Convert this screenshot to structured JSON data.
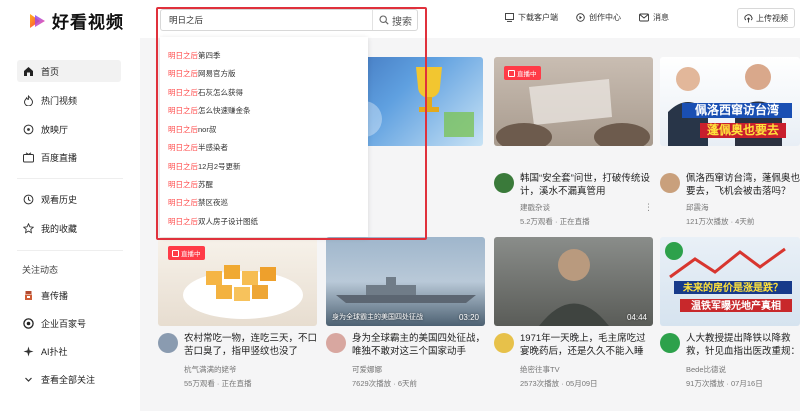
{
  "brand": {
    "name": "好看视频",
    "accent": "#ff3b47"
  },
  "search": {
    "query": "明日之后",
    "button_label": "搜索"
  },
  "header_actions": [
    {
      "label": "下载客户端",
      "icon": "download-client-icon"
    },
    {
      "label": "创作中心",
      "icon": "creator-icon"
    },
    {
      "label": "消息",
      "icon": "message-icon"
    }
  ],
  "upload_label": "上传视频",
  "sidebar": {
    "items": [
      {
        "label": "首页",
        "icon": "home-icon",
        "active": true
      },
      {
        "label": "热门视频",
        "icon": "hot-icon"
      },
      {
        "label": "放映厅",
        "icon": "cinema-icon"
      },
      {
        "label": "百度直播",
        "icon": "live-icon"
      }
    ],
    "items2": [
      {
        "label": "观看历史",
        "icon": "history-icon"
      },
      {
        "label": "我的收藏",
        "icon": "favorite-icon"
      }
    ],
    "follow_heading": "关注动态",
    "follow_items": [
      {
        "label": "喜传播",
        "icon": "xichuanbo-icon"
      },
      {
        "label": "企业百家号",
        "icon": "enterprise-icon"
      },
      {
        "label": "AI扑社",
        "icon": "ai-icon"
      },
      {
        "label": "查看全部关注",
        "icon": "chevron-down-icon"
      }
    ]
  },
  "suggestions": {
    "prefix": "明日之后",
    "items": [
      "第四季",
      "网易官方版",
      "石灰怎么获得",
      "怎么快速赚金条",
      "nor叔",
      "半感染者",
      "12月2号更新",
      "苏醒",
      "禁区夜巡",
      "双人房子设计图纸"
    ]
  },
  "row1": [
    {
      "title": "韩国“安全套”问世，打破传统设计，溪水不漏真管用",
      "author": "建戳杂谈",
      "meta": "5.2万观看 · 正在直播",
      "live_badge": "直播中"
    },
    {
      "title": "佩洛西窜访台湾，蓬佩奥也要去，飞机会被击落吗？",
      "author": "邱震海",
      "meta": "121万次播放 · 4天前",
      "thumb_text_1": "佩洛西窜访台湾",
      "thumb_text_2": "蓬佩奥也要去"
    }
  ],
  "row2": [
    {
      "title": "农村常吃一物，连吃三天，不口苦口臭了，指甲竖纹也没了",
      "author": "杭气满满的姥爷",
      "meta": "55万观看 · 正在直播",
      "live_badge": "直播中"
    },
    {
      "title": "身为全球霸主的美国四处征战，唯独不敢对这三个国家动手",
      "author": "可爱娜娜",
      "meta": "7629次播放 · 6天前",
      "duration": "03:20",
      "caption": "身为全球霸主的美国四处征战"
    },
    {
      "title": "1971年一天晚上，毛主席吃过宴晚药后，还是久久不能入睡",
      "author": "绝密往事TV",
      "meta": "2573次播放 · 05月09日",
      "duration": "04:44"
    },
    {
      "title": "人大教授提出降铁以降救救，针见血指出医改重规：最后",
      "author": "Bede比德说",
      "meta": "91万次播放 · 07月16日",
      "thumb_text_1": "未来的房价是涨是跌？",
      "thumb_text_2": "温铁军曝光地产真相"
    }
  ]
}
